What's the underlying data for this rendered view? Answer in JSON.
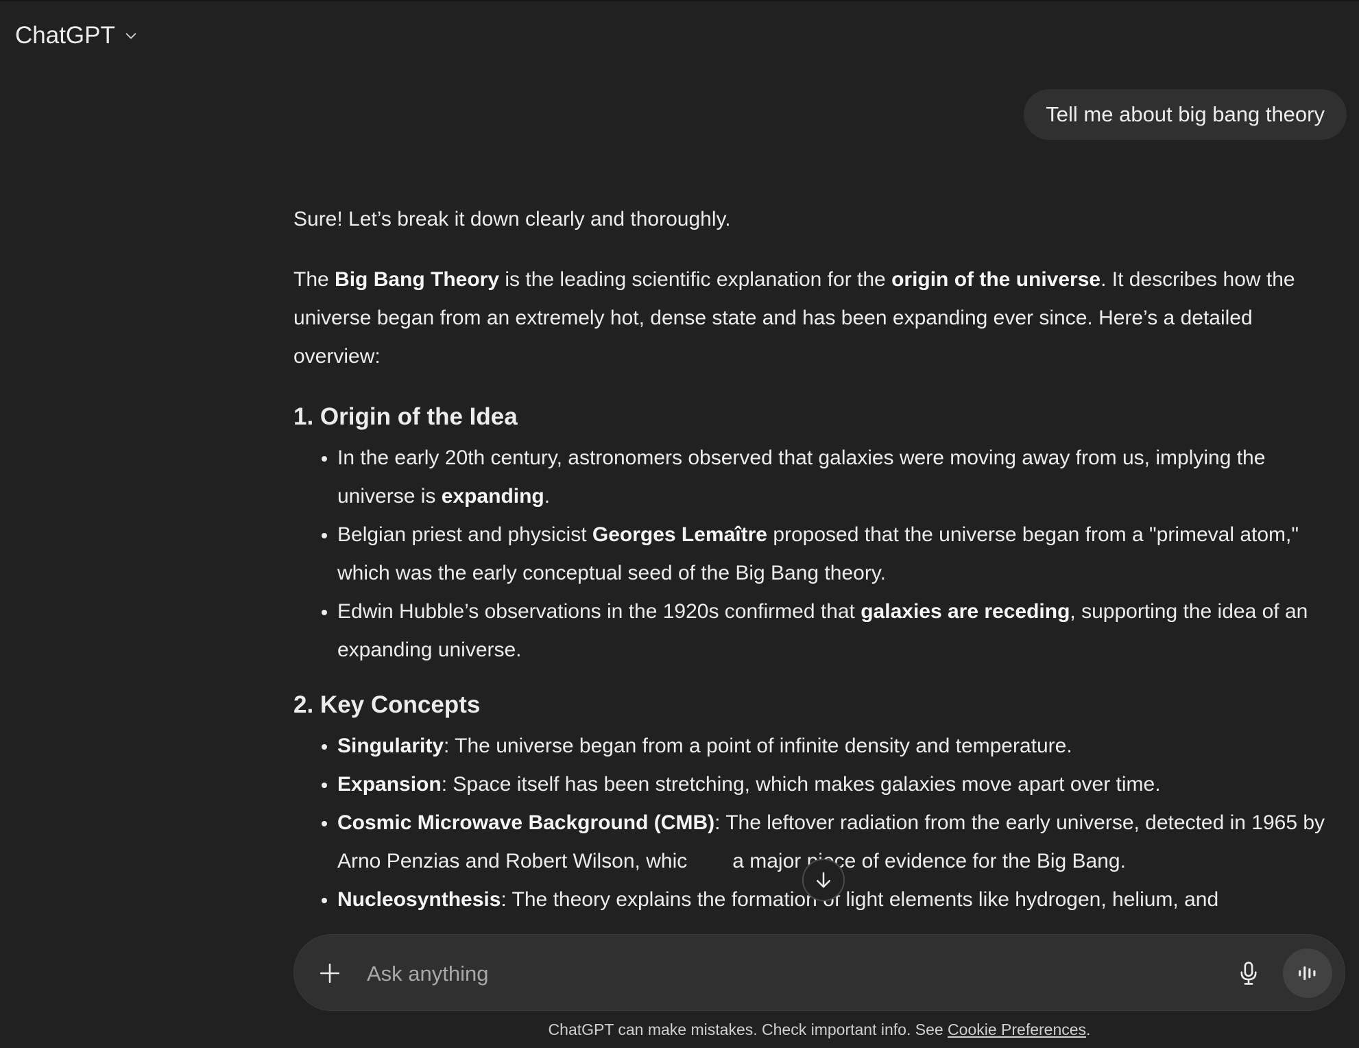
{
  "header": {
    "model_name": "ChatGPT"
  },
  "conversation": {
    "user_message": "Tell me about big bang theory",
    "assistant": {
      "intro": "Sure! Let’s break it down clearly and thoroughly.",
      "para": {
        "t1": "The ",
        "b1": "Big Bang Theory",
        "t2": " is the leading scientific explanation for the ",
        "b2": "origin of the universe",
        "t3": ". It describes how the universe began from an extremely hot, dense state and has been expanding ever since. Here’s a detailed overview:"
      },
      "sections": [
        {
          "heading": "1. Origin of the Idea",
          "items": [
            {
              "t1": "In the early 20th century, astronomers observed that galaxies were moving away from us, implying the universe is ",
              "b1": "expanding",
              "t2": "."
            },
            {
              "t1": "Belgian priest and physicist ",
              "b1": "Georges Lemaître",
              "t2": " proposed that the universe began from a \"primeval atom,\" which was the early conceptual seed of the Big Bang theory."
            },
            {
              "t1": "Edwin Hubble’s observations in the 1920s confirmed that ",
              "b1": "galaxies are receding",
              "t2": ", supporting the idea of an expanding universe."
            }
          ]
        },
        {
          "heading": "2. Key Concepts",
          "items": [
            {
              "b1": "Singularity",
              "t1": ": The universe began from a point of infinite density and temperature."
            },
            {
              "b1": "Expansion",
              "t1": ": Space itself has been stretching, which makes galaxies move apart over time."
            },
            {
              "b1": "Cosmic Microwave Background (CMB)",
              "t1": ": The leftover radiation from the early universe, detected in 1965 by Arno Penzias and Robert Wilson, whic",
              "t1b": "a major piece of evidence for the Big Bang."
            },
            {
              "b1": "Nucleosynthesis",
              "t1": ": The theory explains the formation of light elements like hydrogen, helium, and"
            }
          ]
        }
      ]
    }
  },
  "composer": {
    "placeholder": "Ask anything",
    "icons": {
      "plus": "plus-icon",
      "mic": "microphone-icon",
      "voice": "voice-mode-icon",
      "scroll": "arrow-down-icon"
    }
  },
  "footer": {
    "disclaimer_text": "ChatGPT can make mistakes. Check important info. See ",
    "link_text": "Cookie Preferences",
    "trailing": "."
  },
  "colors": {
    "background": "#212121",
    "bubble": "#303030",
    "text": "#ececec"
  }
}
